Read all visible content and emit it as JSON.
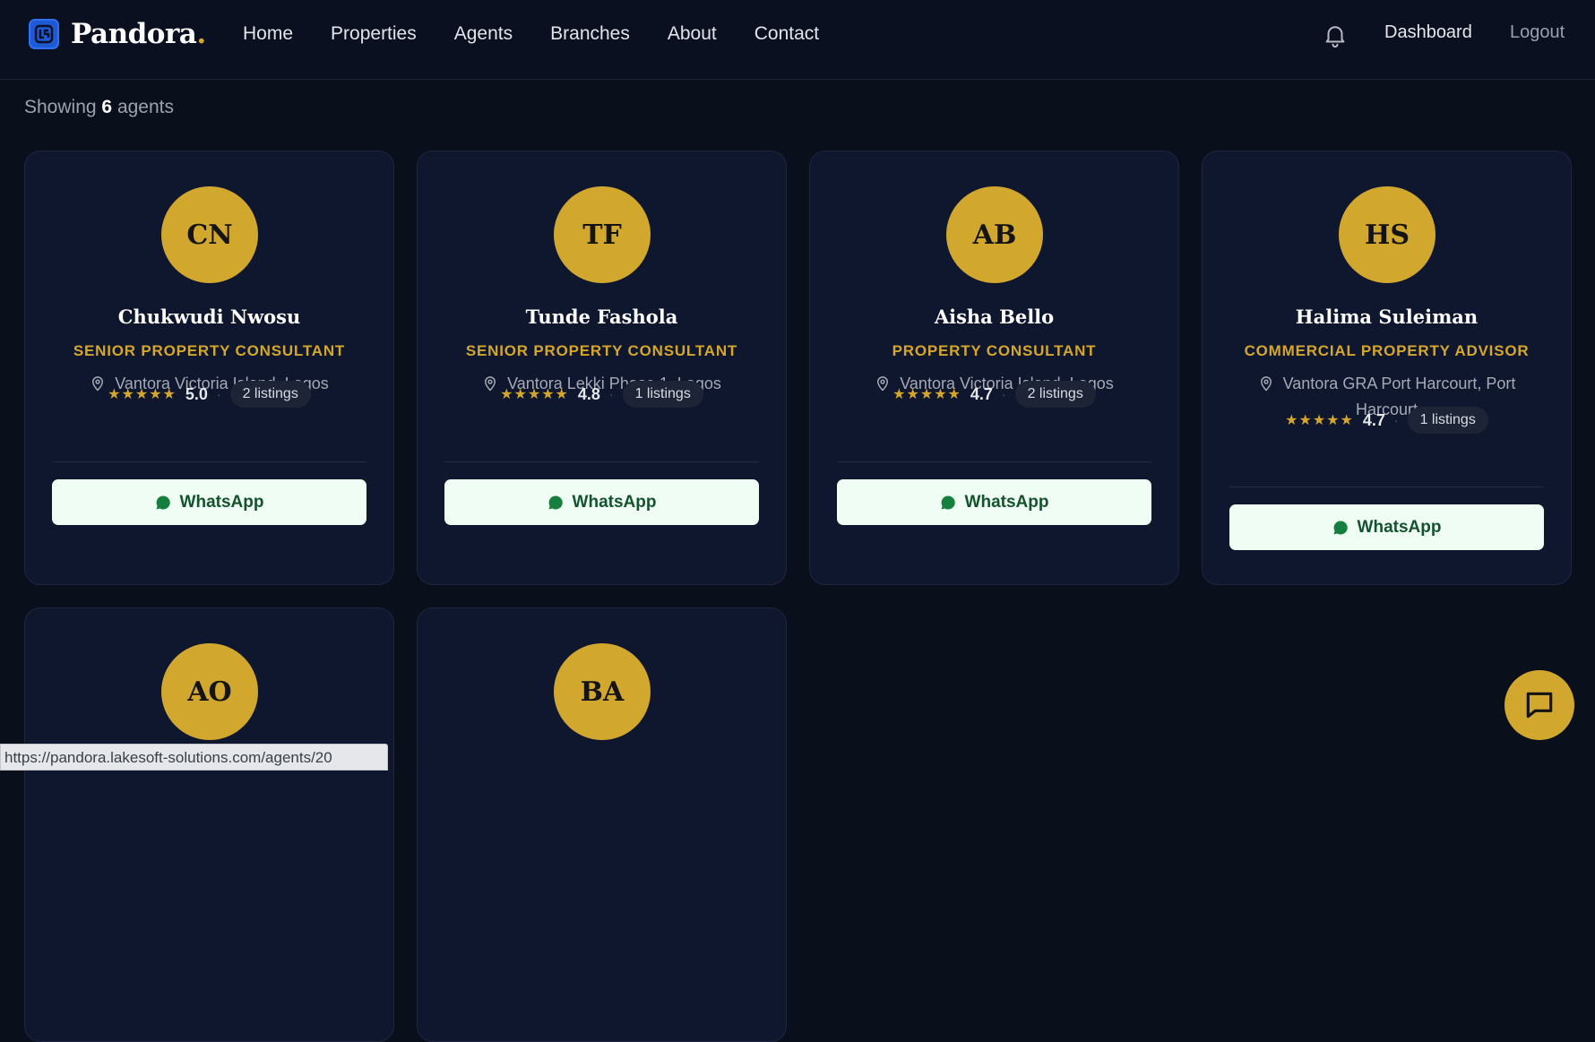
{
  "header": {
    "brand": "Pandora",
    "brand_dot": ".",
    "nav": [
      "Home",
      "Properties",
      "Agents",
      "Branches",
      "About",
      "Contact"
    ],
    "dashboard": "Dashboard",
    "logout": "Logout"
  },
  "summary": {
    "prefix": "Showing",
    "count": "6",
    "suffix": "agents"
  },
  "agents": [
    {
      "initials": "CN",
      "name": "Chukwudi Nwosu",
      "role": "SENIOR PROPERTY CONSULTANT",
      "location": "Vantora Victoria Island, Lagos",
      "rating": "5.0",
      "listings": "2 listings",
      "whatsapp": "WhatsApp"
    },
    {
      "initials": "TF",
      "name": "Tunde Fashola",
      "role": "SENIOR PROPERTY CONSULTANT",
      "location": "Vantora Lekki Phase 1, Lagos",
      "rating": "4.8",
      "listings": "1 listings",
      "whatsapp": "WhatsApp"
    },
    {
      "initials": "AB",
      "name": "Aisha Bello",
      "role": "PROPERTY CONSULTANT",
      "location": "Vantora Victoria Island, Lagos",
      "rating": "4.7",
      "listings": "2 listings",
      "whatsapp": "WhatsApp"
    },
    {
      "initials": "HS",
      "name": "Halima Suleiman",
      "role": "COMMERCIAL PROPERTY ADVISOR",
      "location": "Vantora GRA Port Harcourt, Port Harcourt",
      "rating": "4.7",
      "listings": "1 listings",
      "whatsapp": "WhatsApp"
    },
    {
      "initials": "AO"
    },
    {
      "initials": "BA"
    }
  ],
  "stars": "★★★★★",
  "separator": "·",
  "status_url": "https://pandora.lakesoft-solutions.com/agents/20",
  "colors": {
    "background": "#0a0f1c",
    "card": "#0f172e",
    "accent_gold": "#d4a72c",
    "whatsapp_bg": "#effdf4",
    "whatsapp_text": "#14532d"
  },
  "icons": {
    "logo": "logo-icon",
    "bell": "bell-icon",
    "pin": "map-pin-icon",
    "whatsapp": "whatsapp-icon",
    "chat": "chat-icon"
  }
}
